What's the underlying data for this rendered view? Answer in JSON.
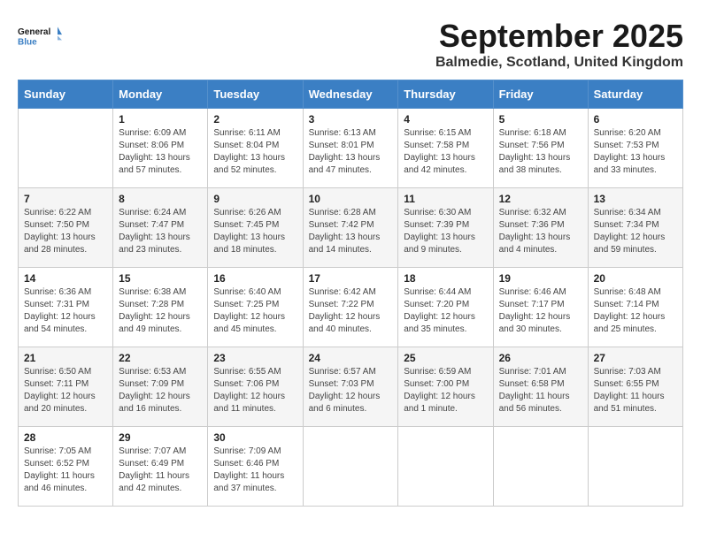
{
  "header": {
    "logo_general": "General",
    "logo_blue": "Blue",
    "month": "September 2025",
    "location": "Balmedie, Scotland, United Kingdom"
  },
  "days_of_week": [
    "Sunday",
    "Monday",
    "Tuesday",
    "Wednesday",
    "Thursday",
    "Friday",
    "Saturday"
  ],
  "weeks": [
    [
      {
        "day": "",
        "content": ""
      },
      {
        "day": "1",
        "content": "Sunrise: 6:09 AM\nSunset: 8:06 PM\nDaylight: 13 hours\nand 57 minutes."
      },
      {
        "day": "2",
        "content": "Sunrise: 6:11 AM\nSunset: 8:04 PM\nDaylight: 13 hours\nand 52 minutes."
      },
      {
        "day": "3",
        "content": "Sunrise: 6:13 AM\nSunset: 8:01 PM\nDaylight: 13 hours\nand 47 minutes."
      },
      {
        "day": "4",
        "content": "Sunrise: 6:15 AM\nSunset: 7:58 PM\nDaylight: 13 hours\nand 42 minutes."
      },
      {
        "day": "5",
        "content": "Sunrise: 6:18 AM\nSunset: 7:56 PM\nDaylight: 13 hours\nand 38 minutes."
      },
      {
        "day": "6",
        "content": "Sunrise: 6:20 AM\nSunset: 7:53 PM\nDaylight: 13 hours\nand 33 minutes."
      }
    ],
    [
      {
        "day": "7",
        "content": "Sunrise: 6:22 AM\nSunset: 7:50 PM\nDaylight: 13 hours\nand 28 minutes."
      },
      {
        "day": "8",
        "content": "Sunrise: 6:24 AM\nSunset: 7:47 PM\nDaylight: 13 hours\nand 23 minutes."
      },
      {
        "day": "9",
        "content": "Sunrise: 6:26 AM\nSunset: 7:45 PM\nDaylight: 13 hours\nand 18 minutes."
      },
      {
        "day": "10",
        "content": "Sunrise: 6:28 AM\nSunset: 7:42 PM\nDaylight: 13 hours\nand 14 minutes."
      },
      {
        "day": "11",
        "content": "Sunrise: 6:30 AM\nSunset: 7:39 PM\nDaylight: 13 hours\nand 9 minutes."
      },
      {
        "day": "12",
        "content": "Sunrise: 6:32 AM\nSunset: 7:36 PM\nDaylight: 13 hours\nand 4 minutes."
      },
      {
        "day": "13",
        "content": "Sunrise: 6:34 AM\nSunset: 7:34 PM\nDaylight: 12 hours\nand 59 minutes."
      }
    ],
    [
      {
        "day": "14",
        "content": "Sunrise: 6:36 AM\nSunset: 7:31 PM\nDaylight: 12 hours\nand 54 minutes."
      },
      {
        "day": "15",
        "content": "Sunrise: 6:38 AM\nSunset: 7:28 PM\nDaylight: 12 hours\nand 49 minutes."
      },
      {
        "day": "16",
        "content": "Sunrise: 6:40 AM\nSunset: 7:25 PM\nDaylight: 12 hours\nand 45 minutes."
      },
      {
        "day": "17",
        "content": "Sunrise: 6:42 AM\nSunset: 7:22 PM\nDaylight: 12 hours\nand 40 minutes."
      },
      {
        "day": "18",
        "content": "Sunrise: 6:44 AM\nSunset: 7:20 PM\nDaylight: 12 hours\nand 35 minutes."
      },
      {
        "day": "19",
        "content": "Sunrise: 6:46 AM\nSunset: 7:17 PM\nDaylight: 12 hours\nand 30 minutes."
      },
      {
        "day": "20",
        "content": "Sunrise: 6:48 AM\nSunset: 7:14 PM\nDaylight: 12 hours\nand 25 minutes."
      }
    ],
    [
      {
        "day": "21",
        "content": "Sunrise: 6:50 AM\nSunset: 7:11 PM\nDaylight: 12 hours\nand 20 minutes."
      },
      {
        "day": "22",
        "content": "Sunrise: 6:53 AM\nSunset: 7:09 PM\nDaylight: 12 hours\nand 16 minutes."
      },
      {
        "day": "23",
        "content": "Sunrise: 6:55 AM\nSunset: 7:06 PM\nDaylight: 12 hours\nand 11 minutes."
      },
      {
        "day": "24",
        "content": "Sunrise: 6:57 AM\nSunset: 7:03 PM\nDaylight: 12 hours\nand 6 minutes."
      },
      {
        "day": "25",
        "content": "Sunrise: 6:59 AM\nSunset: 7:00 PM\nDaylight: 12 hours\nand 1 minute."
      },
      {
        "day": "26",
        "content": "Sunrise: 7:01 AM\nSunset: 6:58 PM\nDaylight: 11 hours\nand 56 minutes."
      },
      {
        "day": "27",
        "content": "Sunrise: 7:03 AM\nSunset: 6:55 PM\nDaylight: 11 hours\nand 51 minutes."
      }
    ],
    [
      {
        "day": "28",
        "content": "Sunrise: 7:05 AM\nSunset: 6:52 PM\nDaylight: 11 hours\nand 46 minutes."
      },
      {
        "day": "29",
        "content": "Sunrise: 7:07 AM\nSunset: 6:49 PM\nDaylight: 11 hours\nand 42 minutes."
      },
      {
        "day": "30",
        "content": "Sunrise: 7:09 AM\nSunset: 6:46 PM\nDaylight: 11 hours\nand 37 minutes."
      },
      {
        "day": "",
        "content": ""
      },
      {
        "day": "",
        "content": ""
      },
      {
        "day": "",
        "content": ""
      },
      {
        "day": "",
        "content": ""
      }
    ]
  ]
}
